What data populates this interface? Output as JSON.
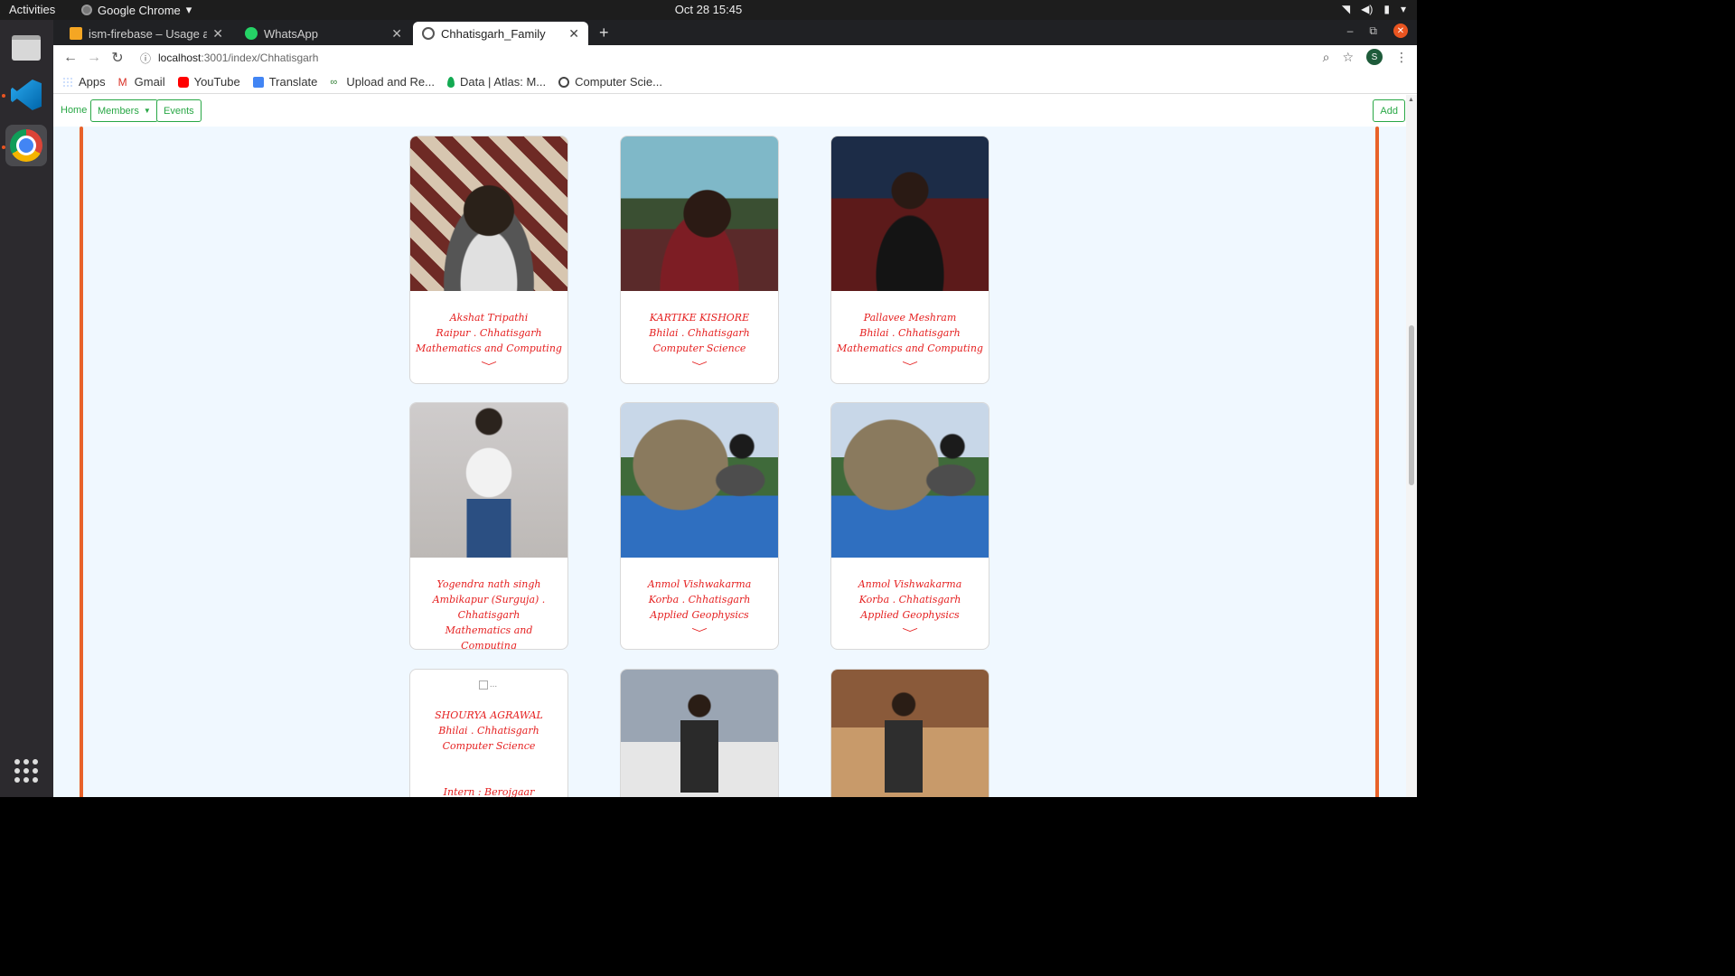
{
  "system": {
    "activities": "Activities",
    "app_name": "Google Chrome",
    "clock": "Oct 28  15:45"
  },
  "browser": {
    "tabs": [
      {
        "title": "ism-firebase – Usage and billing",
        "favicon": "firebase-icon",
        "close": "✕"
      },
      {
        "title": "WhatsApp",
        "favicon": "whatsapp-icon",
        "close": "✕"
      },
      {
        "title": "Chhatisgarh_Family",
        "favicon": "globe-icon",
        "close": "✕"
      }
    ],
    "new_tab": "+",
    "address": {
      "host": "localhost",
      "path": ":3001/index/Chhatisgarh"
    },
    "bookmarks": [
      {
        "label": "Apps",
        "icon": "apps-grid-icon"
      },
      {
        "label": "Gmail",
        "icon": "gmail-icon"
      },
      {
        "label": "YouTube",
        "icon": "youtube-icon"
      },
      {
        "label": "Translate",
        "icon": "translate-icon"
      },
      {
        "label": "Upload and Re...",
        "icon": "link-icon"
      },
      {
        "label": "Data | Atlas: M...",
        "icon": "leaf-icon"
      },
      {
        "label": "Computer Scie...",
        "icon": "globe-icon"
      }
    ],
    "profile_initial": "S"
  },
  "page": {
    "nav": {
      "home": "Home",
      "members": "Members",
      "events": "Events",
      "add": "Add"
    },
    "members": [
      {
        "name": "Akshat Tripathi",
        "place": "Raipur . Chhatisgarh",
        "branch": "Mathematics and Computing",
        "chevron": "﹀"
      },
      {
        "name": "KARTIKE KISHORE",
        "place": "Bhilai . Chhatisgarh",
        "branch": "Computer Science",
        "chevron": "﹀"
      },
      {
        "name": "Pallavee Meshram",
        "place": "Bhilai . Chhatisgarh",
        "branch": "Mathematics and Computing",
        "chevron": "﹀"
      },
      {
        "name": "Yogendra nath singh",
        "place": "Ambikapur (Surguja) . Chhatisgarh",
        "branch": "Mathematics and Computing",
        "chevron": ""
      },
      {
        "name": "Anmol Vishwakarma",
        "place": "Korba . Chhatisgarh",
        "branch": "Applied Geophysics",
        "chevron": "﹀"
      },
      {
        "name": "Anmol Vishwakarma",
        "place": "Korba . Chhatisgarh",
        "branch": "Applied Geophysics",
        "chevron": "﹀"
      },
      {
        "name": "SHOURYA AGRAWAL",
        "place": "Bhilai . Chhatisgarh",
        "branch": "Computer Science",
        "extra": "Intern : Berojgaar",
        "broken_alt": "..."
      }
    ]
  },
  "colors": {
    "accent_green": "#28a745",
    "frame_orange": "#e8622a",
    "text_red": "#e52020",
    "page_bg": "#f0f8ff"
  }
}
